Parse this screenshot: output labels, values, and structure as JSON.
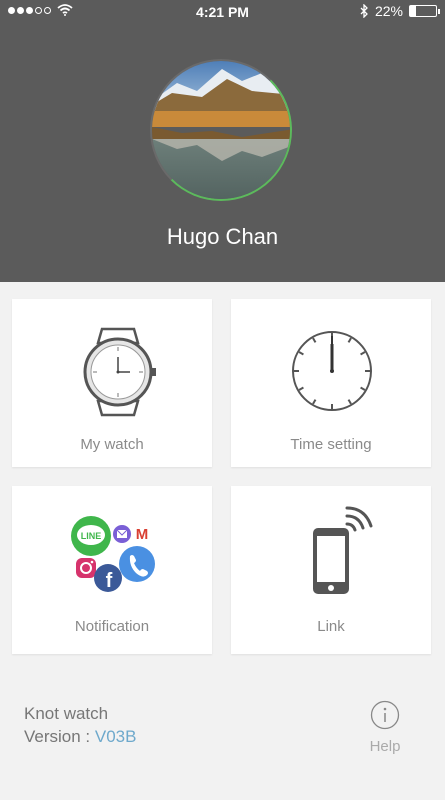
{
  "status_bar": {
    "time": "4:21 PM",
    "battery": "22%",
    "battery_level": 0.22,
    "signal_bars": 3,
    "signal_total": 5
  },
  "profile": {
    "name": "Hugo Chan"
  },
  "menu": [
    {
      "label": "My watch",
      "icon": "watch-icon"
    },
    {
      "label": "Time setting",
      "icon": "clock-icon"
    },
    {
      "label": "Notification",
      "icon": "social-apps-icon"
    },
    {
      "label": "Link",
      "icon": "phone-signal-icon"
    }
  ],
  "footer": {
    "app_name": "Knot watch",
    "version_label": "Version :",
    "version_value": "V03B",
    "help_label": "Help"
  },
  "icon_texts": {
    "line": "LINE",
    "facebook": "f",
    "gmail": "M"
  },
  "colors": {
    "header": "#5b5b5b",
    "background": "#f2f2f2",
    "version_accent": "#6ea9cc",
    "line_green": "#3fb64b",
    "facebook_blue": "#3b5998",
    "phone_blue": "#4a90e2"
  }
}
